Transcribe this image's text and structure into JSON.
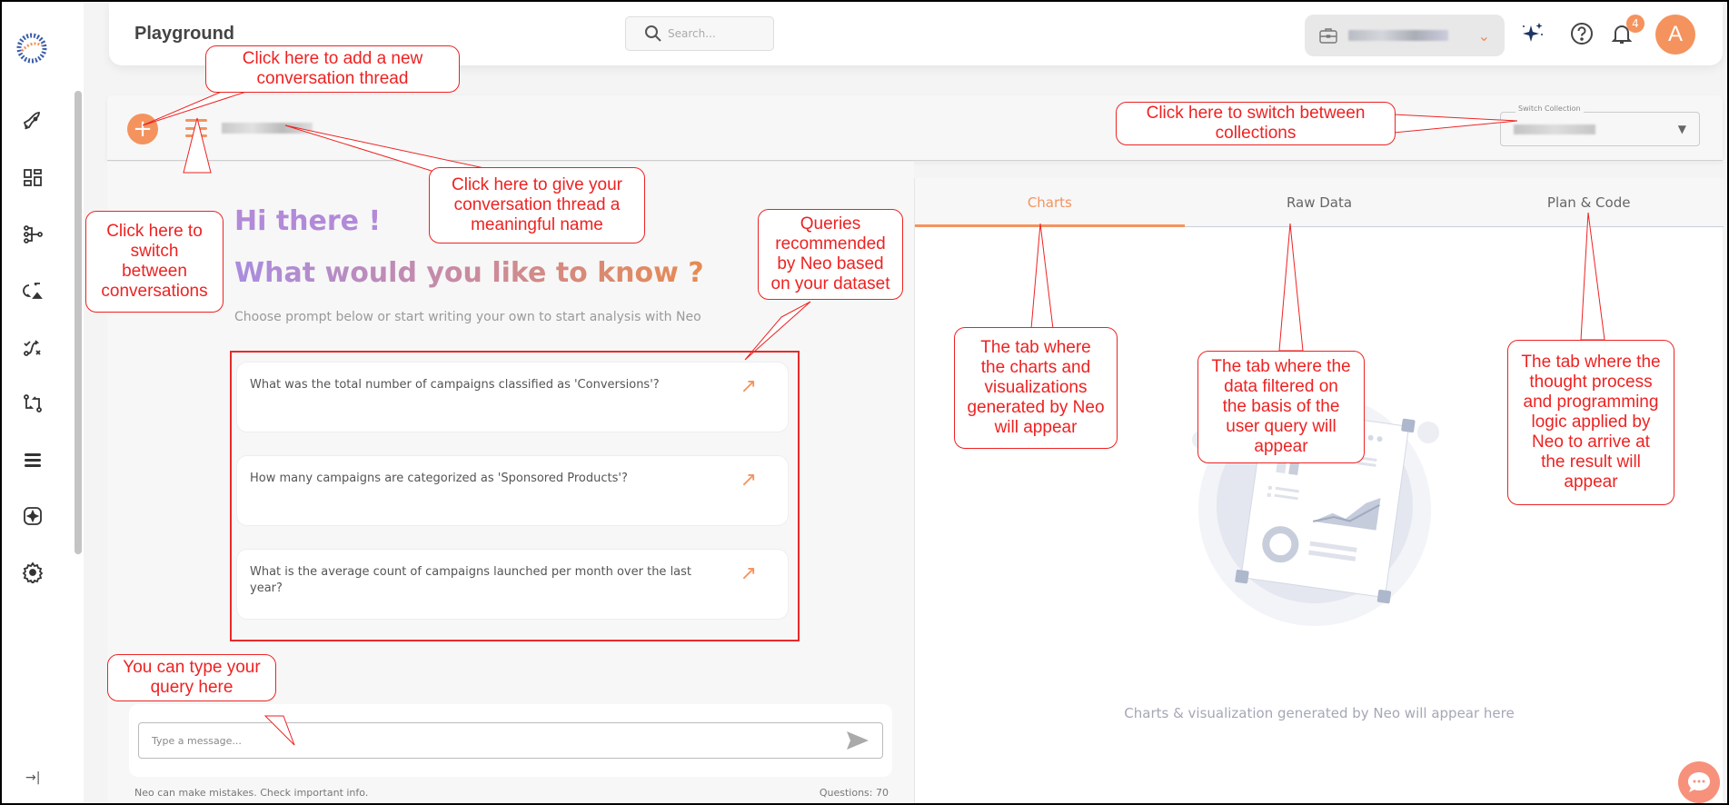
{
  "header": {
    "title": "Playground",
    "search_placeholder": "Search...",
    "notification_count": "4",
    "avatar_initial": "A",
    "accent_color": "#f4935e"
  },
  "sidebar": {
    "items": [
      {
        "icon": "rocket-icon"
      },
      {
        "icon": "dashboard-icon"
      },
      {
        "icon": "workflow-icon"
      },
      {
        "icon": "sync-upload-icon"
      },
      {
        "icon": "route-icon"
      },
      {
        "icon": "pull-request-icon"
      },
      {
        "icon": "list-icon"
      },
      {
        "icon": "sparkle-box-icon"
      },
      {
        "icon": "gear-icon"
      }
    ],
    "collapse_label": "→|"
  },
  "conversation": {
    "collection_label": "Switch Collection"
  },
  "welcome": {
    "greeting": "Hi there !",
    "question": "What would you like to know ?",
    "subtitle": "Choose prompt below or start writing your own to start analysis with Neo"
  },
  "suggestions": [
    {
      "text": "What was the total number of campaigns classified as 'Conversions'?"
    },
    {
      "text": "How many campaigns are categorized as 'Sponsored Products'?"
    },
    {
      "text": "What is the average count of campaigns launched per month over the last year?"
    }
  ],
  "composer": {
    "placeholder": "Type a message...",
    "disclaimer": "Neo can make mistakes. Check important info.",
    "questions_count": "Questions: 70"
  },
  "tabs": [
    {
      "label": "Charts",
      "active": true
    },
    {
      "label": "Raw Data",
      "active": false
    },
    {
      "label": "Plan & Code",
      "active": false
    }
  ],
  "empty_state": "Charts & visualization generated by Neo will appear here",
  "annotations": {
    "add_thread": "Click here to add a new\nconversation thread",
    "switch_collections": "Click here to switch between\ncollections",
    "switch_conversations": "Click here to\nswitch\nbetween\nconversations",
    "name_thread": "Click here to give your\nconversation thread a\nmeaningful name",
    "recommended": "Queries\nrecommended\nby Neo based\non your dataset",
    "type_query": "You can type your\nquery here",
    "charts_tab": "The tab where\nthe charts and\nvisualizations\ngenerated by Neo\nwill appear",
    "raw_tab": "The tab where the\ndata filtered on\nthe basis of the\nuser query will\nappear",
    "plan_tab": "The tab where the\nthought process\nand programming\nlogic applied by\nNeo to arrive at\nthe result will\nappear"
  }
}
